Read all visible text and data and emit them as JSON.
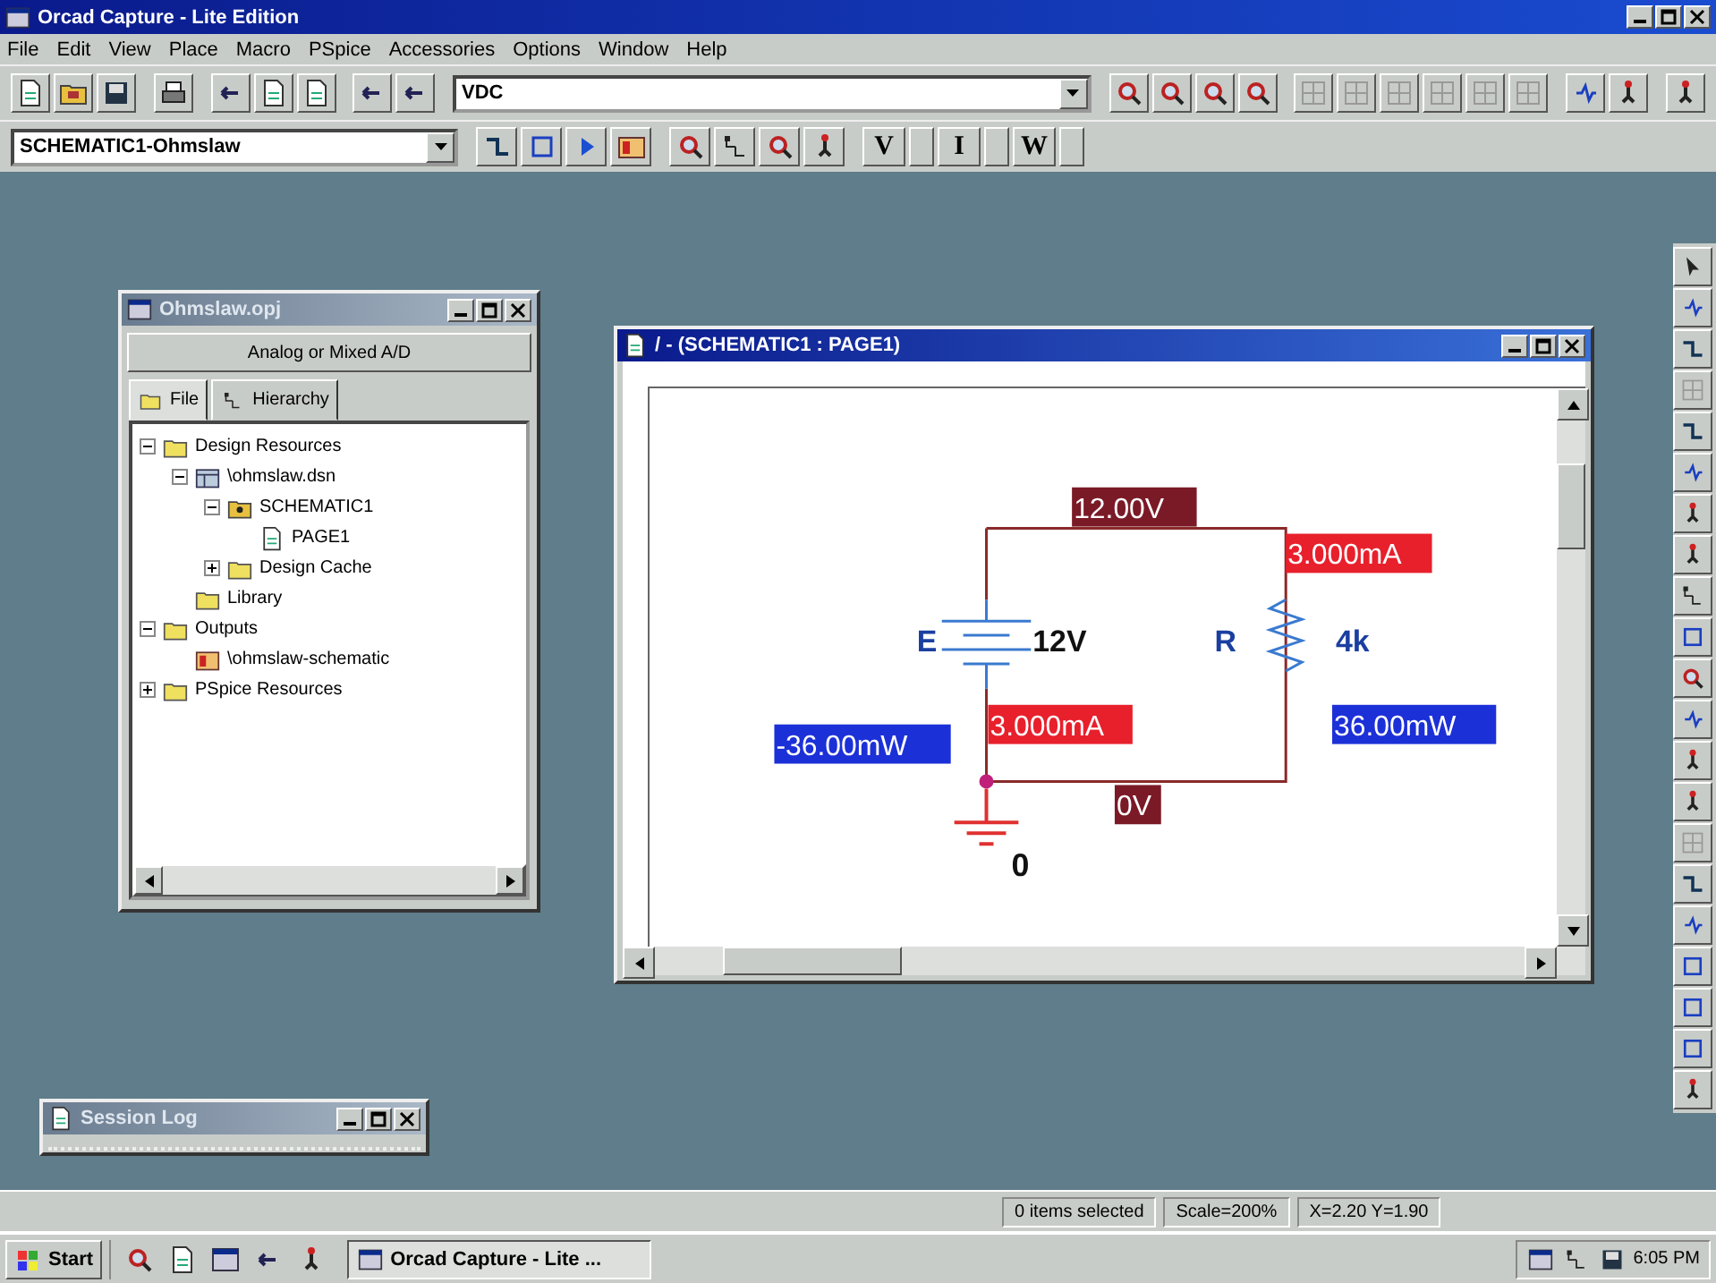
{
  "window": {
    "title": "Orcad Capture - Lite Edition"
  },
  "menu": [
    "File",
    "Edit",
    "View",
    "Place",
    "Macro",
    "PSpice",
    "Accessories",
    "Options",
    "Window",
    "Help"
  ],
  "toolbar": {
    "part_combo": "VDC"
  },
  "toolbar2": {
    "page_combo": "SCHEMATIC1-Ohmslaw",
    "probe_buttons": [
      "V",
      "I",
      "W"
    ]
  },
  "project_window": {
    "title": "Ohmslaw.opj",
    "header": "Analog or Mixed A/D",
    "tabs": [
      {
        "label": "File",
        "selected": true
      },
      {
        "label": "Hierarchy",
        "selected": false
      }
    ],
    "tree": [
      {
        "label": "Design Resources",
        "kind": "folder",
        "expanded": true,
        "children": [
          {
            "label": "\\ohmslaw.dsn",
            "kind": "design",
            "expanded": true,
            "children": [
              {
                "label": "SCHEMATIC1",
                "kind": "schematic",
                "expanded": true,
                "children": [
                  {
                    "label": "PAGE1",
                    "kind": "page"
                  }
                ]
              },
              {
                "label": "Design Cache",
                "kind": "folder",
                "expanded": false
              }
            ]
          },
          {
            "label": "Library",
            "kind": "folder"
          }
        ]
      },
      {
        "label": "Outputs",
        "kind": "folder",
        "expanded": true,
        "children": [
          {
            "label": "\\ohmslaw-schematic",
            "kind": "output"
          }
        ]
      },
      {
        "label": "PSpice Resources",
        "kind": "folder",
        "expanded": false
      }
    ]
  },
  "schematic_window": {
    "title": "/ - (SCHEMATIC1 : PAGE1)",
    "components": [
      {
        "ref": "E",
        "value": "12V"
      },
      {
        "ref": "R",
        "value": "4k"
      }
    ],
    "ground_label": "0",
    "markers": [
      {
        "kind": "voltage",
        "text": "12.00V"
      },
      {
        "kind": "current",
        "text": "3.000mA"
      },
      {
        "kind": "current",
        "text": "3.000mA"
      },
      {
        "kind": "power",
        "text": "-36.00mW"
      },
      {
        "kind": "power",
        "text": "36.00mW"
      },
      {
        "kind": "voltage",
        "text": "0V"
      }
    ]
  },
  "session_log": {
    "title": "Session Log"
  },
  "status_bar": [
    "0 items selected",
    "Scale=200%",
    "X=2.20 Y=1.90"
  ],
  "taskbar": {
    "start": "Start",
    "task": "Orcad Capture - Lite ...",
    "clock": "6:05 PM"
  }
}
